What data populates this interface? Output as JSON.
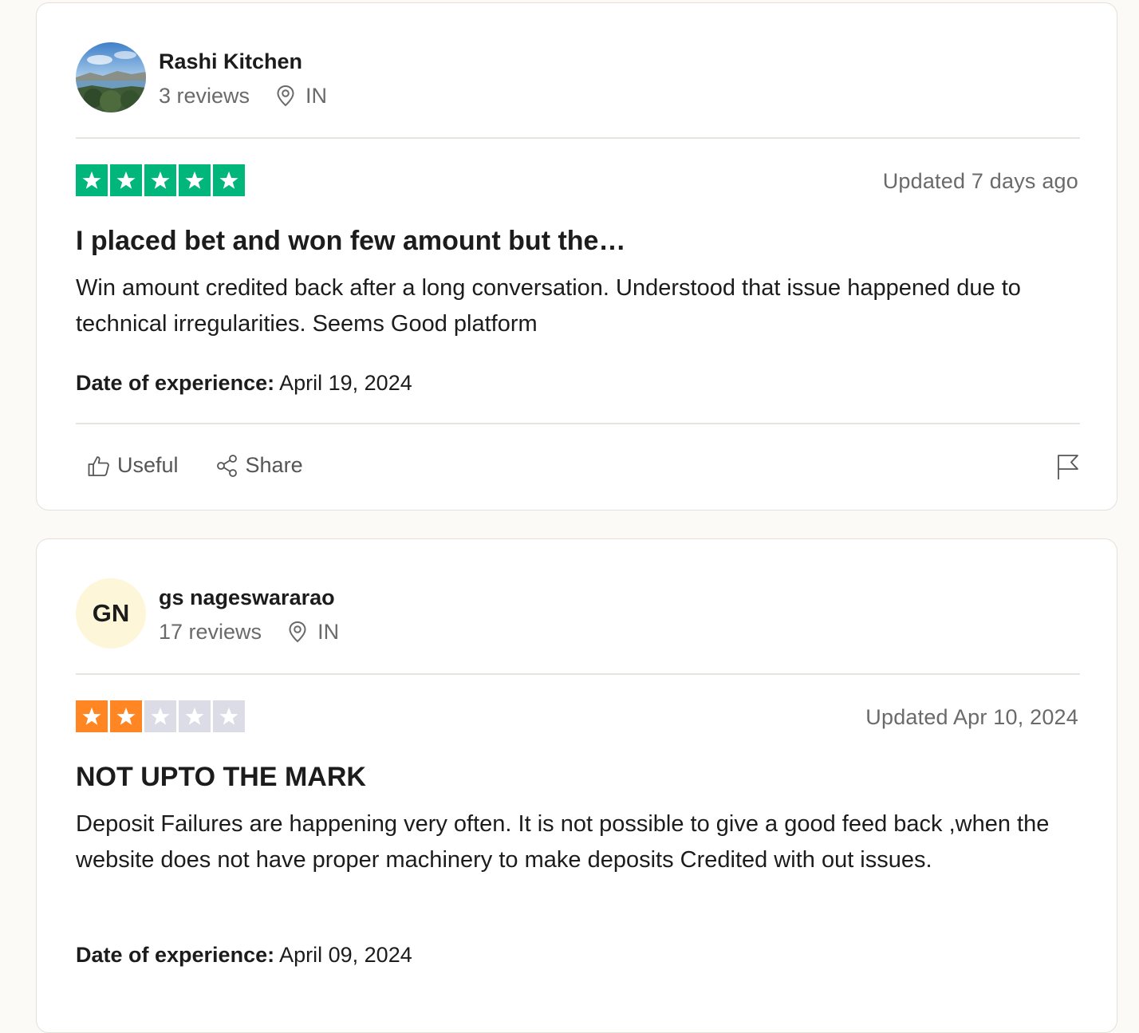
{
  "colors": {
    "star_green": "#00b67a",
    "star_orange": "#ff8622",
    "star_empty": "#dcdce6"
  },
  "reviews": [
    {
      "consumer_name": "Rashi Kitchen",
      "review_count": "3 reviews",
      "country": "IN",
      "avatar_type": "photo-landscape",
      "rating": 5,
      "updated": "Updated 7 days ago",
      "title": "I placed bet and won few amount but the…",
      "body": "Win amount credited back after a long conversation. Understood that issue happened due to technical irregularities. Seems Good platform",
      "experience_label": "Date of experience:",
      "experience_date": "April 19, 2024",
      "actions": {
        "useful": "Useful",
        "share": "Share"
      }
    },
    {
      "consumer_name": "gs nageswararao",
      "avatar_initials": "GN",
      "review_count": "17 reviews",
      "country": "IN",
      "rating": 2,
      "updated": "Updated Apr 10, 2024",
      "title": "NOT UPTO THE MARK",
      "body": "Deposit Failures are happening very often. It is not possible to give a good feed back ,when the website does not have proper machinery to make deposits Credited with out issues.",
      "experience_label": "Date of experience:",
      "experience_date": "April 09, 2024"
    }
  ]
}
